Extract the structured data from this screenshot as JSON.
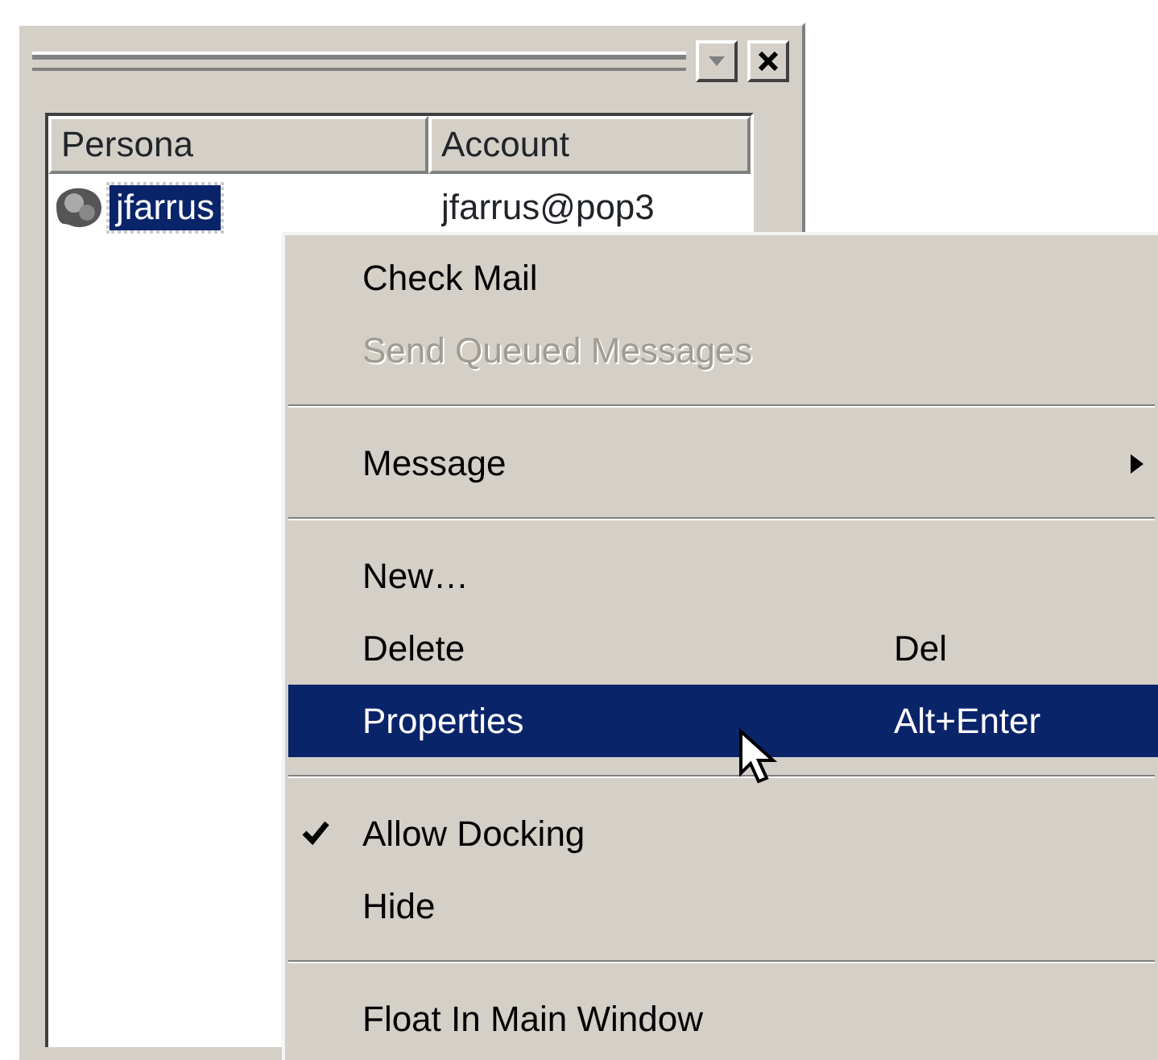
{
  "list": {
    "columns": [
      "Persona",
      "Account"
    ],
    "rows": [
      {
        "persona": "jfarrus",
        "account": "jfarrus@pop3",
        "selected": true
      }
    ]
  },
  "context_menu": {
    "items": [
      {
        "kind": "item",
        "label": "Check Mail",
        "disabled": false,
        "selected": false,
        "checked": false,
        "submenu": false
      },
      {
        "kind": "item",
        "label": "Send Queued Messages",
        "disabled": true,
        "selected": false,
        "checked": false,
        "submenu": false
      },
      {
        "kind": "separator"
      },
      {
        "kind": "item",
        "label": "Message",
        "disabled": false,
        "selected": false,
        "checked": false,
        "submenu": true
      },
      {
        "kind": "separator"
      },
      {
        "kind": "item",
        "label": "New…",
        "disabled": false,
        "selected": false,
        "checked": false,
        "submenu": false
      },
      {
        "kind": "item",
        "label": "Delete",
        "shortcut": "Del",
        "disabled": false,
        "selected": false,
        "checked": false,
        "submenu": false
      },
      {
        "kind": "item",
        "label": "Properties",
        "shortcut": "Alt+Enter",
        "disabled": false,
        "selected": true,
        "checked": false,
        "submenu": false
      },
      {
        "kind": "separator"
      },
      {
        "kind": "item",
        "label": "Allow Docking",
        "disabled": false,
        "selected": false,
        "checked": true,
        "submenu": false
      },
      {
        "kind": "item",
        "label": "Hide",
        "disabled": false,
        "selected": false,
        "checked": false,
        "submenu": false
      },
      {
        "kind": "separator"
      },
      {
        "kind": "item",
        "label": "Float In Main Window",
        "disabled": false,
        "selected": false,
        "checked": false,
        "submenu": false
      }
    ]
  }
}
